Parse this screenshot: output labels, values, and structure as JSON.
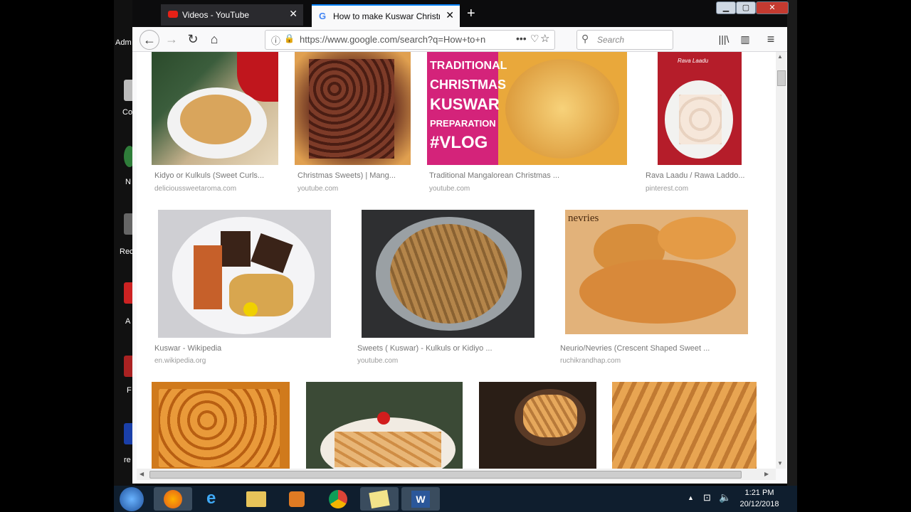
{
  "desktop": {
    "labels": [
      "Adm",
      "Co",
      "N",
      "Rec",
      "A",
      "F",
      "re"
    ]
  },
  "tabs": [
    {
      "label": "Videos - YouTube",
      "icon": "youtube-icon"
    },
    {
      "label": "How to make Kuswar Christmas",
      "icon": "google-icon"
    }
  ],
  "url": "https://www.google.com/search?q=How+to+n",
  "search": {
    "placeholder": "Search"
  },
  "results": [
    {
      "caption": "Kidyo or Kulkuls (Sweet Curls...",
      "source": "delicioussweetaroma.com"
    },
    {
      "caption": "Christmas Sweets) | Mang...",
      "source": "youtube.com"
    },
    {
      "caption": "Traditional Mangalorean Christmas ...",
      "source": "youtube.com",
      "overlay": [
        "TRADITIONAL",
        "CHRISTMAS",
        "KUSWAR",
        "PREPARATION",
        "#VLOG"
      ]
    },
    {
      "caption": "Rava Laadu / Rawa Laddo...",
      "source": "pinterest.com",
      "overlay": [
        "Rava Laadu"
      ]
    },
    {
      "caption": "Kuswar - Wikipedia",
      "source": "en.wikipedia.org"
    },
    {
      "caption": "Sweets ( Kuswar) - Kulkuls or Kidiyo ...",
      "source": "youtube.com"
    },
    {
      "caption": "Neurio/Nevries (Crescent Shaped Sweet ...",
      "source": "ruchikrandhap.com",
      "overlay": [
        "nevries"
      ]
    }
  ],
  "taskbar": {
    "time": "1:21 PM",
    "date": "20/12/2018"
  },
  "colors": {
    "accent": "#0a84ff",
    "taskbar": "#0f1e2e"
  }
}
